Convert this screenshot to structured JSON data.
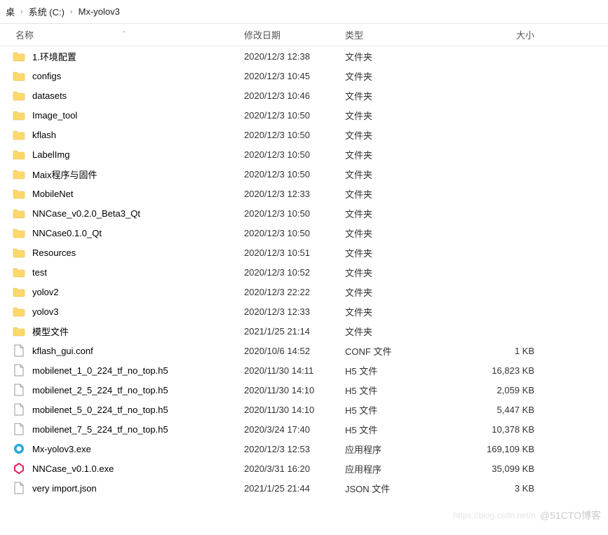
{
  "breadcrumb": {
    "seg0_suffix": "桌",
    "sep": "›",
    "seg1": "系统 (C:)",
    "seg2": "Mx-yolov3"
  },
  "columns": {
    "name": "名称",
    "date": "修改日期",
    "type": "类型",
    "size": "大小",
    "sort_glyph": "ˇ"
  },
  "icons": {
    "folder": "folder",
    "file_generic": "file",
    "exe_blue": "exe-blue",
    "exe_pink": "exe-pink"
  },
  "files": [
    {
      "icon": "folder",
      "name": "1.环境配置",
      "date": "2020/12/3 12:38",
      "type": "文件夹",
      "size": ""
    },
    {
      "icon": "folder",
      "name": "configs",
      "date": "2020/12/3 10:45",
      "type": "文件夹",
      "size": ""
    },
    {
      "icon": "folder",
      "name": "datasets",
      "date": "2020/12/3 10:46",
      "type": "文件夹",
      "size": ""
    },
    {
      "icon": "folder",
      "name": "Image_tool",
      "date": "2020/12/3 10:50",
      "type": "文件夹",
      "size": ""
    },
    {
      "icon": "folder",
      "name": "kflash",
      "date": "2020/12/3 10:50",
      "type": "文件夹",
      "size": ""
    },
    {
      "icon": "folder",
      "name": "LabelImg",
      "date": "2020/12/3 10:50",
      "type": "文件夹",
      "size": ""
    },
    {
      "icon": "folder",
      "name": "Maix程序与固件",
      "date": "2020/12/3 10:50",
      "type": "文件夹",
      "size": ""
    },
    {
      "icon": "folder",
      "name": "MobileNet",
      "date": "2020/12/3 12:33",
      "type": "文件夹",
      "size": ""
    },
    {
      "icon": "folder",
      "name": "NNCase_v0.2.0_Beta3_Qt",
      "date": "2020/12/3 10:50",
      "type": "文件夹",
      "size": ""
    },
    {
      "icon": "folder",
      "name": "NNCase0.1.0_Qt",
      "date": "2020/12/3 10:50",
      "type": "文件夹",
      "size": ""
    },
    {
      "icon": "folder",
      "name": "Resources",
      "date": "2020/12/3 10:51",
      "type": "文件夹",
      "size": ""
    },
    {
      "icon": "folder",
      "name": "test",
      "date": "2020/12/3 10:52",
      "type": "文件夹",
      "size": ""
    },
    {
      "icon": "folder",
      "name": "yolov2",
      "date": "2020/12/3 22:22",
      "type": "文件夹",
      "size": ""
    },
    {
      "icon": "folder",
      "name": "yolov3",
      "date": "2020/12/3 12:33",
      "type": "文件夹",
      "size": ""
    },
    {
      "icon": "folder",
      "name": "模型文件",
      "date": "2021/1/25 21:14",
      "type": "文件夹",
      "size": ""
    },
    {
      "icon": "file",
      "name": "kflash_gui.conf",
      "date": "2020/10/6 14:52",
      "type": "CONF 文件",
      "size": "1 KB"
    },
    {
      "icon": "file",
      "name": "mobilenet_1_0_224_tf_no_top.h5",
      "date": "2020/11/30 14:11",
      "type": "H5 文件",
      "size": "16,823 KB"
    },
    {
      "icon": "file",
      "name": "mobilenet_2_5_224_tf_no_top.h5",
      "date": "2020/11/30 14:10",
      "type": "H5 文件",
      "size": "2,059 KB"
    },
    {
      "icon": "file",
      "name": "mobilenet_5_0_224_tf_no_top.h5",
      "date": "2020/11/30 14:10",
      "type": "H5 文件",
      "size": "5,447 KB"
    },
    {
      "icon": "file",
      "name": "mobilenet_7_5_224_tf_no_top.h5",
      "date": "2020/3/24 17:40",
      "type": "H5 文件",
      "size": "10,378 KB"
    },
    {
      "icon": "exe-blue",
      "name": "Mx-yolov3.exe",
      "date": "2020/12/3 12:53",
      "type": "应用程序",
      "size": "169,109 KB"
    },
    {
      "icon": "exe-pink",
      "name": "NNCase_v0.1.0.exe",
      "date": "2020/3/31 16:20",
      "type": "应用程序",
      "size": "35,099 KB"
    },
    {
      "icon": "file",
      "name": "very import.json",
      "date": "2021/1/25 21:44",
      "type": "JSON 文件",
      "size": "3 KB"
    }
  ],
  "watermark": {
    "csdn": "https://blog.csdn.net/n",
    "text": "@51CTO博客"
  }
}
